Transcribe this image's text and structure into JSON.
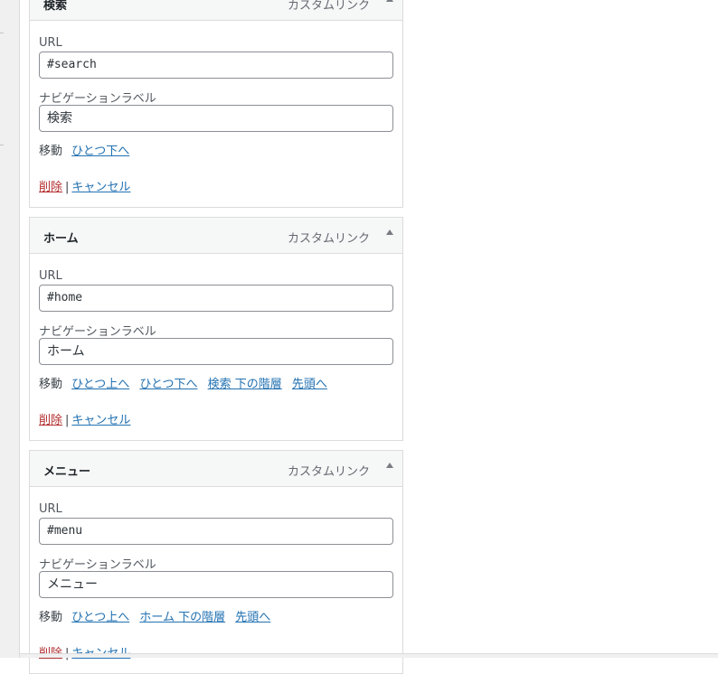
{
  "labels": {
    "url": "URL",
    "nav_label": "ナビゲーションラベル",
    "move": "移動",
    "delete": "削除",
    "separator": "|",
    "cancel": "キャンセル"
  },
  "items": [
    {
      "title": "検索",
      "type": "カスタムリンク",
      "url": "#search",
      "nav_label": "検索",
      "move_links": [
        "ひとつ下へ"
      ]
    },
    {
      "title": "ホーム",
      "type": "カスタムリンク",
      "url": "#home",
      "nav_label": "ホーム",
      "move_links": [
        "ひとつ上へ",
        "ひとつ下へ",
        "検索 下の階層",
        "先頭へ"
      ]
    },
    {
      "title": "メニュー",
      "type": "カスタムリンク",
      "url": "#menu",
      "nav_label": "メニュー",
      "move_links": [
        "ひとつ上へ",
        "ホーム 下の階層",
        "先頭へ"
      ]
    }
  ]
}
